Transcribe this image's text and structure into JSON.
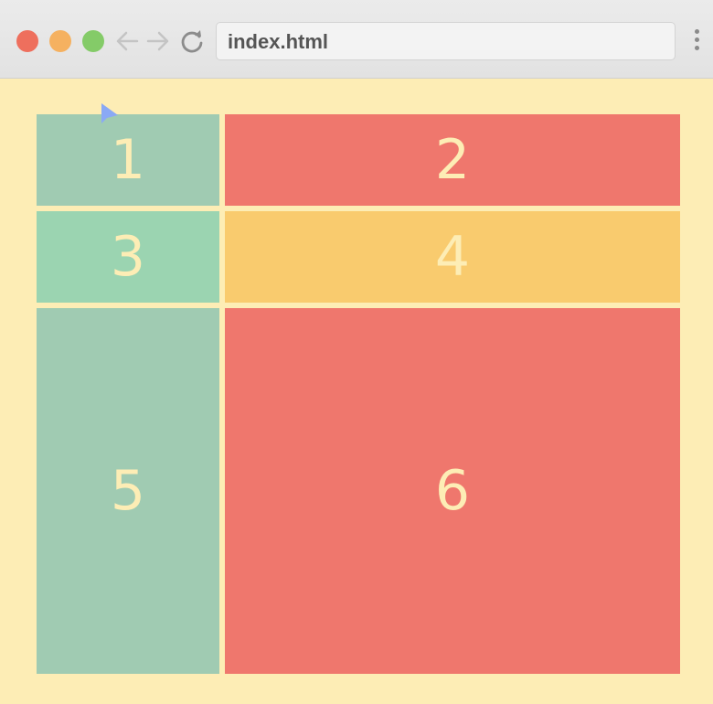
{
  "browser": {
    "address": "index.html",
    "colors": {
      "close": "#ee6f5d",
      "minimize": "#f5b160",
      "maximize": "#84cb68"
    }
  },
  "grid": {
    "cells": [
      {
        "label": "1",
        "color": "#a0cbb2"
      },
      {
        "label": "2",
        "color": "#ef776d"
      },
      {
        "label": "3",
        "color": "#9bd4b1"
      },
      {
        "label": "4",
        "color": "#f9cb6e"
      },
      {
        "label": "5",
        "color": "#a0cbb2"
      },
      {
        "label": "6",
        "color": "#ef776d"
      }
    ]
  },
  "page": {
    "background": "#fdedb5"
  },
  "cursor": {
    "color": "#8aa9f5"
  }
}
